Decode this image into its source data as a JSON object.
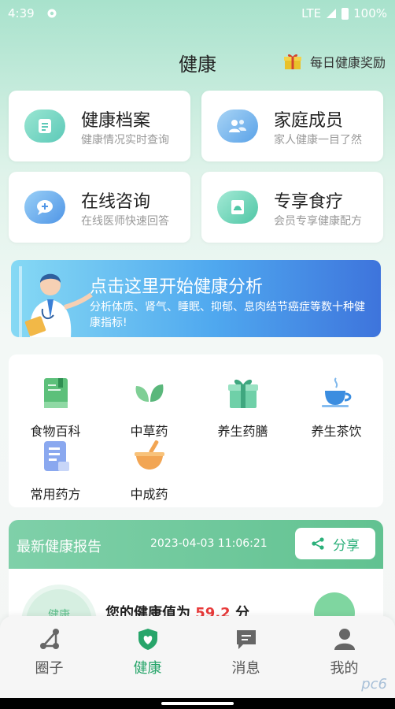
{
  "status": {
    "time": "4:39",
    "network": "LTE",
    "battery": "100%"
  },
  "header": {
    "title": "健康",
    "reward": "每日健康奖励"
  },
  "cards": [
    {
      "title": "健康档案",
      "subtitle": "健康情况实时查询",
      "icon": "file-icon"
    },
    {
      "title": "家庭成员",
      "subtitle": "家人健康一目了然",
      "icon": "people-icon"
    },
    {
      "title": "在线咨询",
      "subtitle": "在线医师快速回答",
      "icon": "chat-icon"
    },
    {
      "title": "专享食疗",
      "subtitle": "会员专享健康配方",
      "icon": "book-icon"
    }
  ],
  "banner": {
    "title": "点击这里开始健康分析",
    "desc": "分析体质、肾气、睡眠、抑郁、息肉结节癌症等数十种健康指标!"
  },
  "categories": [
    {
      "label": "食物百科",
      "icon": "green-book-icon"
    },
    {
      "label": "中草药",
      "icon": "leaves-icon"
    },
    {
      "label": "养生药膳",
      "icon": "gift-box-icon"
    },
    {
      "label": "养生茶饮",
      "icon": "tea-cup-icon"
    },
    {
      "label": "常用药方",
      "icon": "prescription-icon"
    },
    {
      "label": "中成药",
      "icon": "mortar-bowl-icon"
    }
  ],
  "report": {
    "title": "最新健康报告",
    "date": "2023-04-03 11:06:21",
    "share": "分享",
    "circle_label": "健康",
    "score_prefix": "您的健康值为",
    "score": "59.2",
    "score_unit": "分"
  },
  "nav": [
    {
      "label": "圈子",
      "icon": "share-nodes-icon",
      "active": false
    },
    {
      "label": "健康",
      "icon": "shield-heart-icon",
      "active": true
    },
    {
      "label": "消息",
      "icon": "message-icon",
      "active": false
    },
    {
      "label": "我的",
      "icon": "person-icon",
      "active": false
    }
  ],
  "watermark": "pc6",
  "colors": {
    "accent": "#27a56a",
    "report_header": "#6cc79a",
    "score": "#e83b3b"
  }
}
